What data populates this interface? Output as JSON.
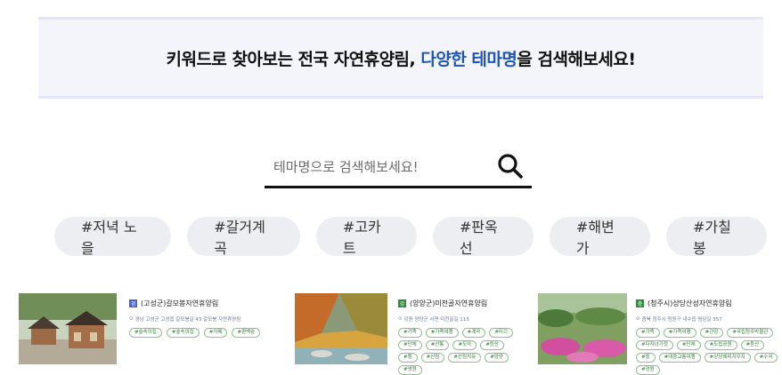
{
  "banner": {
    "text_before": "키워드로 찾아보는 전국 자연휴양림, ",
    "highlight": "다양한 테마명",
    "text_after": "을 검색해보세요!"
  },
  "search": {
    "placeholder": "테마명으로 검색해보세요!",
    "value": ""
  },
  "tags": [
    "#저녁 노을",
    "#갈거계곡",
    "#고카트",
    "#판옥선",
    "#해변가",
    "#가칠봉"
  ],
  "cards": [
    {
      "title": "(고성군)갈모봉자연휴양림",
      "badge_color": "#4a63c9",
      "address": "경남 고성군 고성읍 갈모봉길 43 갈모봉 자연휴양림",
      "keywords": [
        "#숲속의집",
        "#숲속의집",
        "#카페",
        "#편백숲"
      ]
    },
    {
      "title": "(양양군)미천골자연휴양림",
      "badge_color": "#2e8b3a",
      "address": "강원 양양군 서면 미천골길 115",
      "keywords": [
        "#가족",
        "#가족여행",
        "#계곡",
        "#미끄",
        "#단체",
        "#산통",
        "#도마",
        "#등산",
        "#캠",
        "#산림",
        "#산림치유",
        "#양양",
        "#영원"
      ]
    },
    {
      "title": "(청주시)상당산성자연휴양림",
      "badge_color": "#2e8b3a",
      "address": "충북 청주시 청원구 내수읍 명암길 357",
      "keywords": [
        "#가족",
        "#가족여행",
        "#관광",
        "#국립청주박물관",
        "#다자녀가정",
        "#단체",
        "#도립공원",
        "#등산",
        "#동",
        "#대중교통여행",
        "#상당헤피지우지",
        "#수국",
        "#양원"
      ]
    }
  ]
}
